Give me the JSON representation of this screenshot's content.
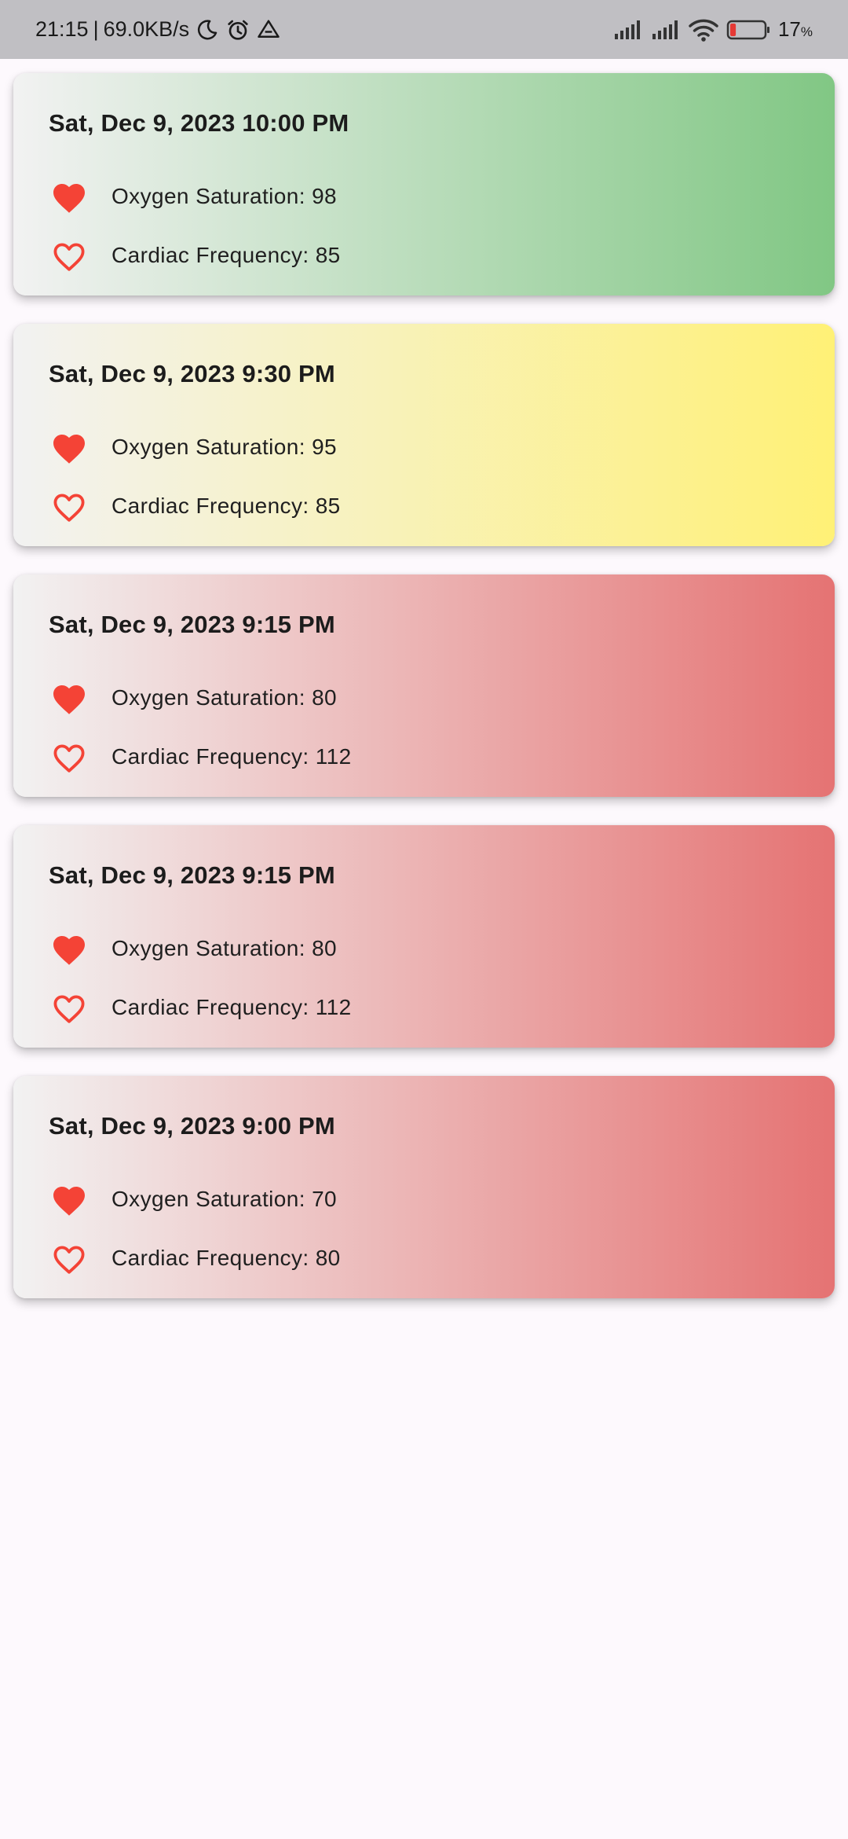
{
  "status_bar": {
    "time": "21:15",
    "separator": "|",
    "network_speed": "69.0KB/s",
    "left_icons": [
      "moon-icon",
      "alarm-icon",
      "drive-icon"
    ],
    "right_icons": [
      "signal-icon",
      "signal-icon",
      "wifi-icon",
      "battery-icon"
    ],
    "battery_percent": "17",
    "battery_unit": "%",
    "battery_level": 0.17
  },
  "colors": {
    "heart": "#f44336",
    "green": "#81c784",
    "yellow": "#fff176",
    "red": "#e57373",
    "card_start": "#f2f2f2"
  },
  "records": [
    {
      "datetime": "Sat, Dec 9, 2023 10:00 PM",
      "oxygen": "Oxygen Saturation: 98",
      "cardiac": "Cardiac Frequency: 85",
      "status_color": "#81c784"
    },
    {
      "datetime": "Sat, Dec 9, 2023 9:30 PM",
      "oxygen": "Oxygen Saturation: 95",
      "cardiac": "Cardiac Frequency: 85",
      "status_color": "#fff176"
    },
    {
      "datetime": "Sat, Dec 9, 2023 9:15 PM",
      "oxygen": "Oxygen Saturation: 80",
      "cardiac": "Cardiac Frequency: 112",
      "status_color": "#e57373"
    },
    {
      "datetime": "Sat, Dec 9, 2023 9:15 PM",
      "oxygen": "Oxygen Saturation: 80",
      "cardiac": "Cardiac Frequency: 112",
      "status_color": "#e57373"
    },
    {
      "datetime": "Sat, Dec 9, 2023 9:00 PM",
      "oxygen": "Oxygen Saturation: 70",
      "cardiac": "Cardiac Frequency: 80",
      "status_color": "#e57373"
    }
  ]
}
